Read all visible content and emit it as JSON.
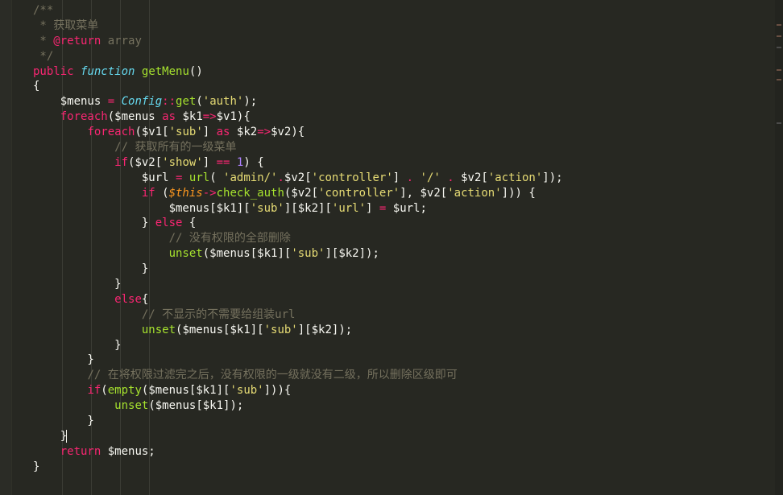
{
  "lines": [
    [
      [
        "cm",
        "/**"
      ]
    ],
    [
      [
        "cm",
        " * 获取菜单"
      ]
    ],
    [
      [
        "cm",
        " * "
      ],
      [
        "kw",
        "@return"
      ],
      [
        "cm",
        " array"
      ]
    ],
    [
      [
        "cm",
        " */"
      ]
    ],
    [
      [
        "kw",
        "public"
      ],
      [
        "pl",
        " "
      ],
      [
        "st",
        "function"
      ],
      [
        "pl",
        " "
      ],
      [
        "fn",
        "getMenu"
      ],
      [
        "pl",
        "()"
      ]
    ],
    [
      [
        "pl",
        "{"
      ]
    ],
    [
      [
        "pl",
        "    $menus "
      ],
      [
        "kw",
        "="
      ],
      [
        "pl",
        " "
      ],
      [
        "cls",
        "Config"
      ],
      [
        "kw",
        "::"
      ],
      [
        "fn",
        "get"
      ],
      [
        "pl",
        "("
      ],
      [
        "str",
        "'auth'"
      ],
      [
        "pl",
        ");"
      ]
    ],
    [
      [
        "pl",
        "    "
      ],
      [
        "kw",
        "foreach"
      ],
      [
        "pl",
        "($menus "
      ],
      [
        "kw",
        "as"
      ],
      [
        "pl",
        " $k1"
      ],
      [
        "kw",
        "=>"
      ],
      [
        "pl",
        "$v1){"
      ]
    ],
    [
      [
        "pl",
        "        "
      ],
      [
        "kw",
        "foreach"
      ],
      [
        "pl",
        "($v1["
      ],
      [
        "str",
        "'sub'"
      ],
      [
        "pl",
        "] "
      ],
      [
        "kw",
        "as"
      ],
      [
        "pl",
        " $k2"
      ],
      [
        "kw",
        "=>"
      ],
      [
        "pl",
        "$v2){"
      ]
    ],
    [
      [
        "pl",
        "            "
      ],
      [
        "cm",
        "// 获取所有的一级菜单"
      ]
    ],
    [
      [
        "pl",
        "            "
      ],
      [
        "kw",
        "if"
      ],
      [
        "pl",
        "($v2["
      ],
      [
        "str",
        "'show'"
      ],
      [
        "pl",
        "] "
      ],
      [
        "kw",
        "=="
      ],
      [
        "pl",
        " "
      ],
      [
        "num",
        "1"
      ],
      [
        "pl",
        ") {"
      ]
    ],
    [
      [
        "pl",
        "                $url "
      ],
      [
        "kw",
        "="
      ],
      [
        "pl",
        " "
      ],
      [
        "fn",
        "url"
      ],
      [
        "pl",
        "( "
      ],
      [
        "str",
        "'admin/'"
      ],
      [
        "kw",
        "."
      ],
      [
        "pl",
        "$v2["
      ],
      [
        "str",
        "'controller'"
      ],
      [
        "pl",
        "] "
      ],
      [
        "kw",
        "."
      ],
      [
        "pl",
        " "
      ],
      [
        "str",
        "'/'"
      ],
      [
        "pl",
        " "
      ],
      [
        "kw",
        "."
      ],
      [
        "pl",
        " $v2["
      ],
      [
        "str",
        "'action'"
      ],
      [
        "pl",
        "]);"
      ]
    ],
    [
      [
        "pl",
        "                "
      ],
      [
        "kw",
        "if"
      ],
      [
        "pl",
        " ("
      ],
      [
        "th",
        "$this"
      ],
      [
        "kw",
        "->"
      ],
      [
        "fn",
        "check_auth"
      ],
      [
        "pl",
        "($v2["
      ],
      [
        "str",
        "'controller'"
      ],
      [
        "pl",
        "], $v2["
      ],
      [
        "str",
        "'action'"
      ],
      [
        "pl",
        "])) {"
      ]
    ],
    [
      [
        "pl",
        "                    $menus[$k1]["
      ],
      [
        "str",
        "'sub'"
      ],
      [
        "pl",
        "][$k2]["
      ],
      [
        "str",
        "'url'"
      ],
      [
        "pl",
        "] "
      ],
      [
        "kw",
        "="
      ],
      [
        "pl",
        " $url;"
      ]
    ],
    [
      [
        "pl",
        "                } "
      ],
      [
        "kw",
        "else"
      ],
      [
        "pl",
        " {"
      ]
    ],
    [
      [
        "pl",
        "                    "
      ],
      [
        "cm",
        "// 没有权限的全部删除"
      ]
    ],
    [
      [
        "pl",
        "                    "
      ],
      [
        "fn",
        "unset"
      ],
      [
        "pl",
        "($menus[$k1]["
      ],
      [
        "str",
        "'sub'"
      ],
      [
        "pl",
        "][$k2]);"
      ]
    ],
    [
      [
        "pl",
        "                }"
      ]
    ],
    [
      [
        "pl",
        "            }"
      ]
    ],
    [
      [
        "pl",
        "            "
      ],
      [
        "kw",
        "else"
      ],
      [
        "pl",
        "{"
      ]
    ],
    [
      [
        "pl",
        "                "
      ],
      [
        "cm",
        "// 不显示的不需要给组装url"
      ]
    ],
    [
      [
        "pl",
        "                "
      ],
      [
        "fn",
        "unset"
      ],
      [
        "pl",
        "($menus[$k1]["
      ],
      [
        "str",
        "'sub'"
      ],
      [
        "pl",
        "][$k2]);"
      ]
    ],
    [
      [
        "pl",
        "            }"
      ]
    ],
    [
      [
        "pl",
        "        }"
      ]
    ],
    [
      [
        "pl",
        "        "
      ],
      [
        "cm",
        "// 在将权限过滤完之后，没有权限的一级就没有二级，所以删除区级即可"
      ]
    ],
    [
      [
        "pl",
        "        "
      ],
      [
        "kw",
        "if"
      ],
      [
        "pl",
        "("
      ],
      [
        "fn",
        "empty"
      ],
      [
        "pl",
        "($menus[$k1]["
      ],
      [
        "str",
        "'sub'"
      ],
      [
        "pl",
        "])){"
      ]
    ],
    [
      [
        "pl",
        "            "
      ],
      [
        "fn",
        "unset"
      ],
      [
        "pl",
        "($menus[$k1]);"
      ]
    ],
    [
      [
        "pl",
        "        }"
      ]
    ],
    [
      [
        "pl",
        "    }"
      ],
      [
        "cur",
        ""
      ]
    ],
    [
      [
        "pl",
        "    "
      ],
      [
        "kw",
        "return"
      ],
      [
        "pl",
        " $menus;"
      ]
    ],
    [
      [
        "pl",
        "}"
      ]
    ]
  ],
  "colors": {
    "background": "#272822",
    "plain": "#f8f8f2",
    "comment": "#75715e",
    "keyword": "#f92672",
    "storage": "#66d9ef",
    "function": "#a6e22e",
    "class": "#66d9ef",
    "string": "#e6db74",
    "number": "#ae81ff",
    "this": "#fd971f"
  }
}
